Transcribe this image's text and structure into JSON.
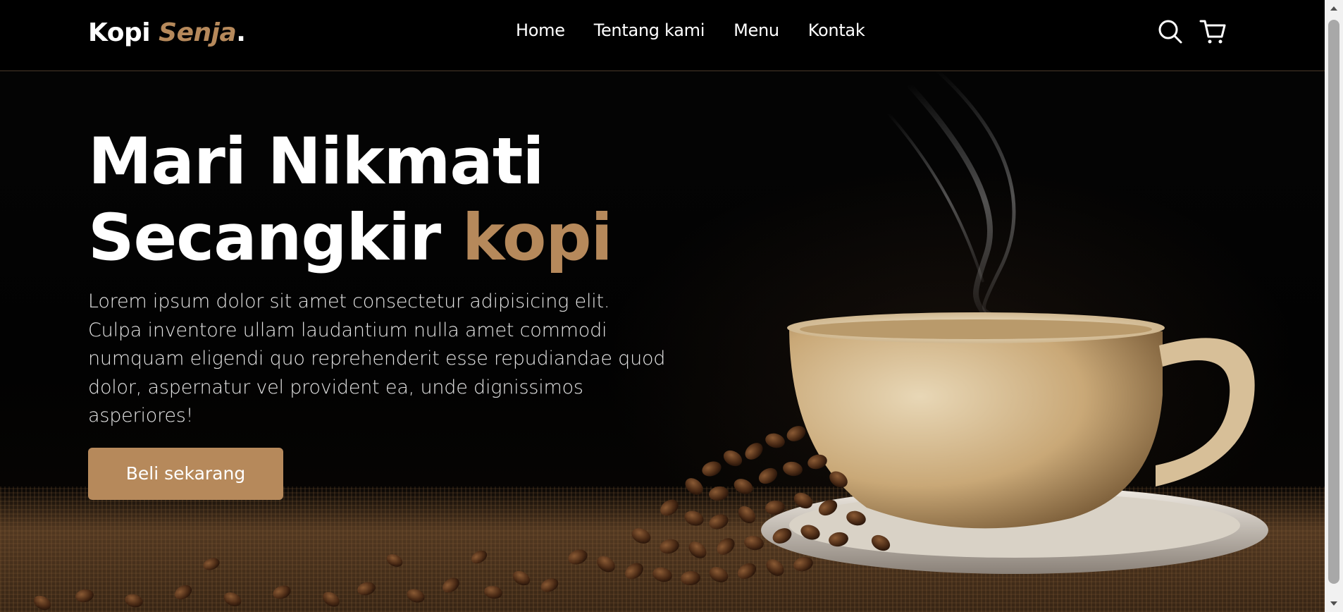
{
  "brand": {
    "name_part1": "Kopi ",
    "name_part2": "Senja",
    "name_suffix": ".",
    "accent_color": "#b6895b"
  },
  "nav": {
    "links": [
      "Home",
      "Tentang kami",
      "Menu",
      "Kontak"
    ],
    "icons": [
      "search-icon",
      "shopping-cart-icon"
    ]
  },
  "hero": {
    "title_line1": "Mari Nikmati",
    "title_line2_part1": "Secangkir ",
    "title_line2_part2": "kopi",
    "description": "Lorem ipsum dolor sit amet consectetur adipisicing elit. Culpa inventore ullam laudantium nulla amet commodi numquam eligendi quo reprehenderit esse repudiandae quod dolor, aspernatur vel provident ea, unde dignissimos asperiores!",
    "cta_label": "Beli sekarang",
    "image": "steaming-coffee-cup-with-beans"
  },
  "colors": {
    "background": "#010101",
    "accent": "#b6895b",
    "text": "#ffffff"
  }
}
